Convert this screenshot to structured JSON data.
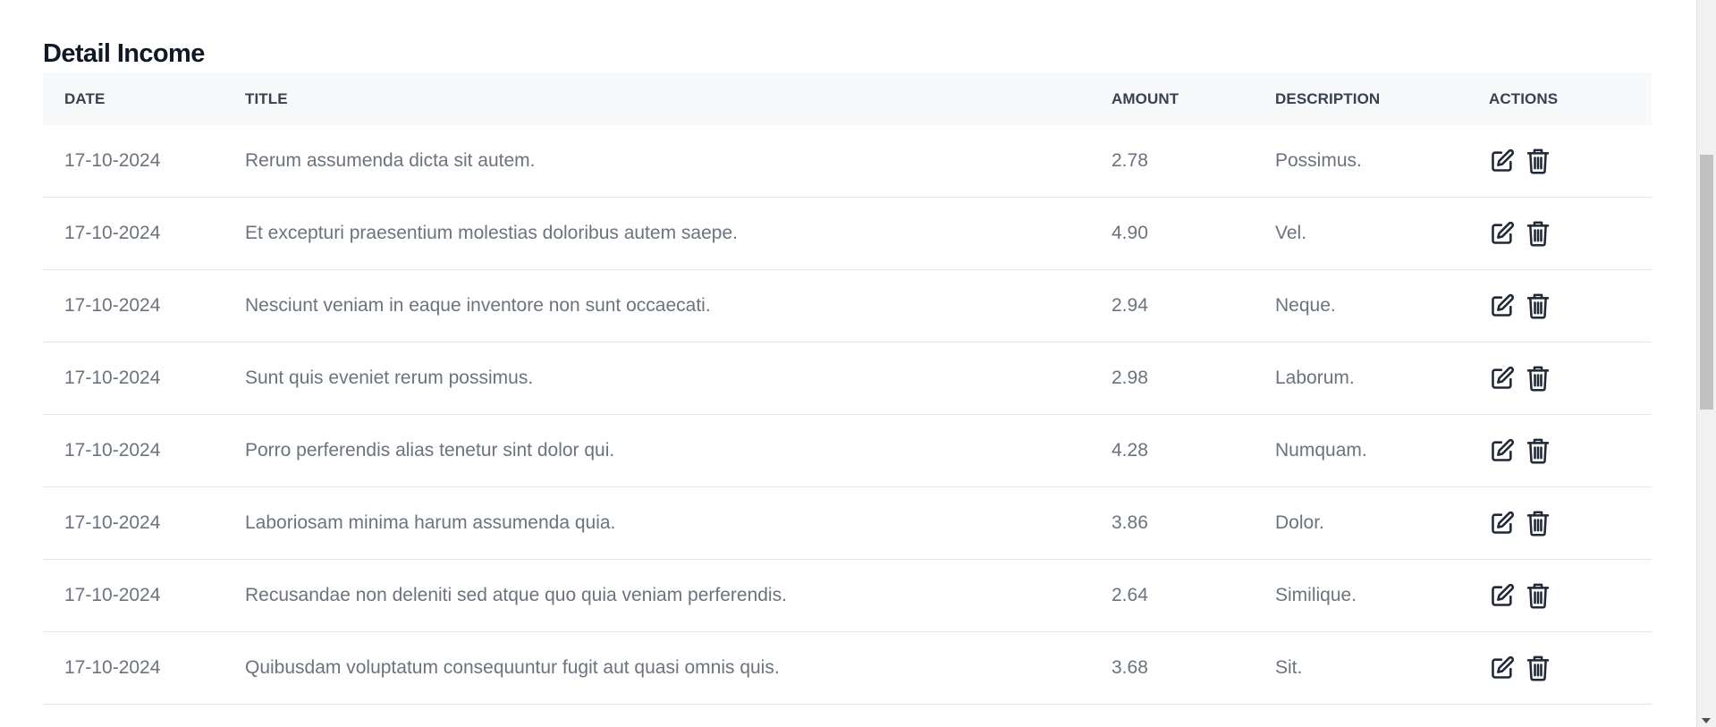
{
  "page": {
    "title": "Detail Income"
  },
  "table": {
    "headers": {
      "date": "DATE",
      "title": "TITLE",
      "amount": "AMOUNT",
      "description": "DESCRIPTION",
      "actions": "ACTIONS"
    },
    "rows": [
      {
        "date": "17-10-2024",
        "title": "Rerum assumenda dicta sit autem.",
        "amount": "2.78",
        "description": "Possimus."
      },
      {
        "date": "17-10-2024",
        "title": "Et excepturi praesentium molestias doloribus autem saepe.",
        "amount": "4.90",
        "description": "Vel."
      },
      {
        "date": "17-10-2024",
        "title": "Nesciunt veniam in eaque inventore non sunt occaecati.",
        "amount": "2.94",
        "description": "Neque."
      },
      {
        "date": "17-10-2024",
        "title": "Sunt quis eveniet rerum possimus.",
        "amount": "2.98",
        "description": "Laborum."
      },
      {
        "date": "17-10-2024",
        "title": "Porro perferendis alias tenetur sint dolor qui.",
        "amount": "4.28",
        "description": "Numquam."
      },
      {
        "date": "17-10-2024",
        "title": "Laboriosam minima harum assumenda quia.",
        "amount": "3.86",
        "description": "Dolor."
      },
      {
        "date": "17-10-2024",
        "title": "Recusandae non deleniti sed atque quo quia veniam perferendis.",
        "amount": "2.64",
        "description": "Similique."
      },
      {
        "date": "17-10-2024",
        "title": "Quibusdam voluptatum consequuntur fugit aut quasi omnis quis.",
        "amount": "3.68",
        "description": "Sit."
      }
    ]
  },
  "icons": {
    "edit": "edit-icon",
    "delete": "trash-icon"
  },
  "colors": {
    "heading": "#111827",
    "header_bg": "#f8f9fb",
    "cell_text": "#6b7280",
    "icon": "#1f2937"
  }
}
